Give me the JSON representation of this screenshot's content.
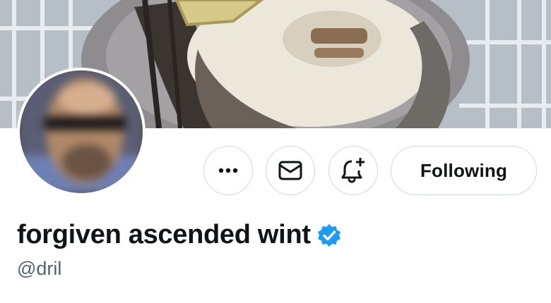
{
  "profile": {
    "display_name": "forgiven ascended wint",
    "handle": "@dril",
    "verified": true
  },
  "actions": {
    "more_icon": "more-horizontal-icon",
    "message_icon": "envelope-icon",
    "notify_icon": "bell-plus-icon",
    "follow_label": "Following"
  },
  "colors": {
    "verified_badge": "#1d9bf0",
    "text_primary": "#0f1419",
    "text_secondary": "#536471",
    "button_border": "#cfd9de"
  }
}
